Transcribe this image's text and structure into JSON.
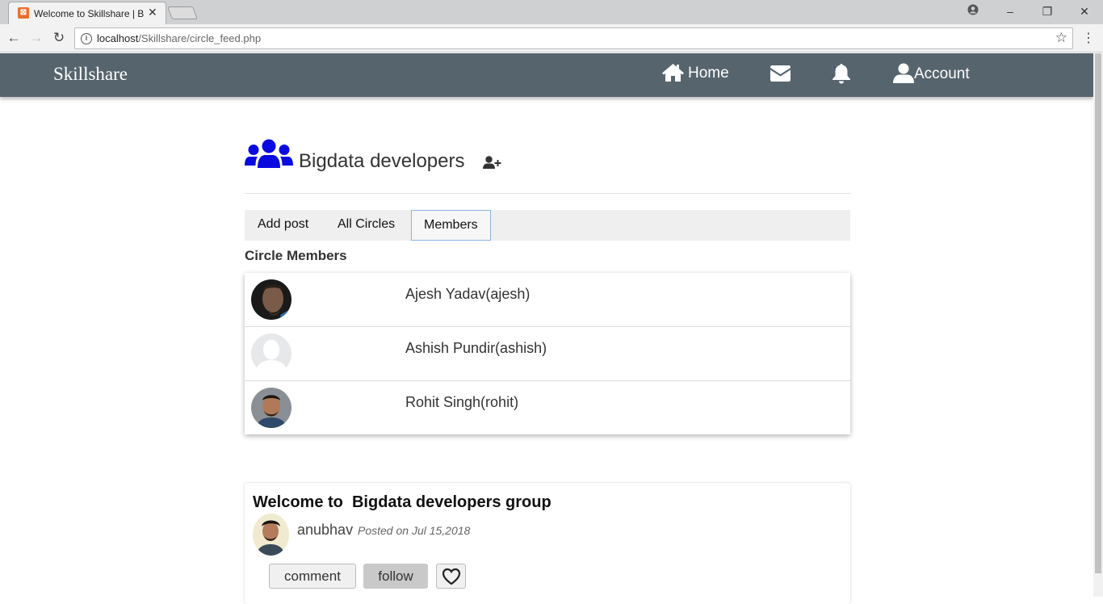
{
  "browser": {
    "tab_title": "Welcome to Skillshare | B",
    "url_host": "localhost",
    "url_path": "/Skillshare/circle_feed.php"
  },
  "navbar": {
    "brand": "Skillshare",
    "home_label": "Home",
    "account_label": "Account"
  },
  "circle": {
    "title": "Bigdata developers",
    "tabs": [
      "Add post",
      "All Circles",
      "Members"
    ],
    "active_tab": "Members",
    "members_heading": "Circle Members",
    "members": [
      {
        "name": "Ajesh Yadav(ajesh)",
        "avatar": "photo-dark"
      },
      {
        "name": "Ashish Pundir(ashish)",
        "avatar": "default-silhouette"
      },
      {
        "name": "Rohit Singh(rohit)",
        "avatar": "photo"
      }
    ]
  },
  "post": {
    "title": "Welcome to  Bigdata developers group",
    "author": "anubhav",
    "date": "Posted on Jul 15,2018",
    "comment_label": "comment",
    "follow_label": "follow"
  },
  "colors": {
    "navbar_bg": "#56646d",
    "group_icon": "#0a0ae0",
    "active_tab_border": "#8ab0e6"
  }
}
